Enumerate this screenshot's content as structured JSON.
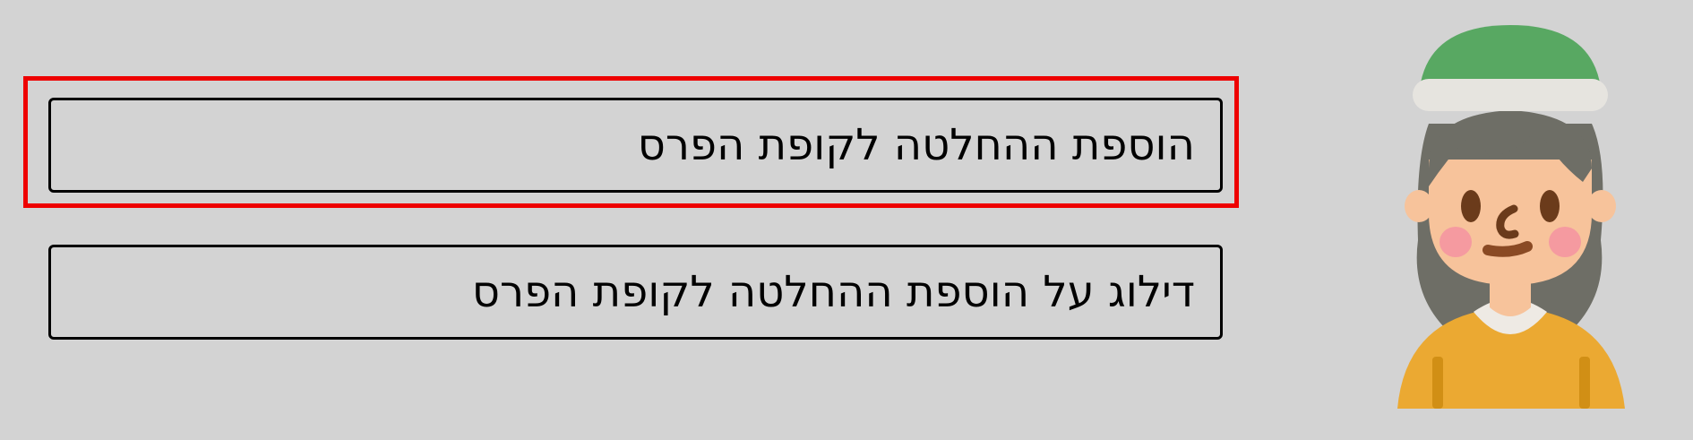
{
  "dialog": {
    "choices": [
      {
        "label": "הוספת ההחלטה לקופת הפרס",
        "selected": true
      },
      {
        "label": "דילוג על הוספת ההחלטה לקופת הפרס",
        "selected": false
      }
    ],
    "highlight_color": "#ee0000"
  },
  "avatar": {
    "icon": "girl-avatar-icon",
    "colors": {
      "hat": "#58a862",
      "hat_band": "#e6e4df",
      "hair": "#6e6e66",
      "skin": "#f7c39b",
      "shirt": "#eba932",
      "collar": "#eeeae4"
    }
  }
}
